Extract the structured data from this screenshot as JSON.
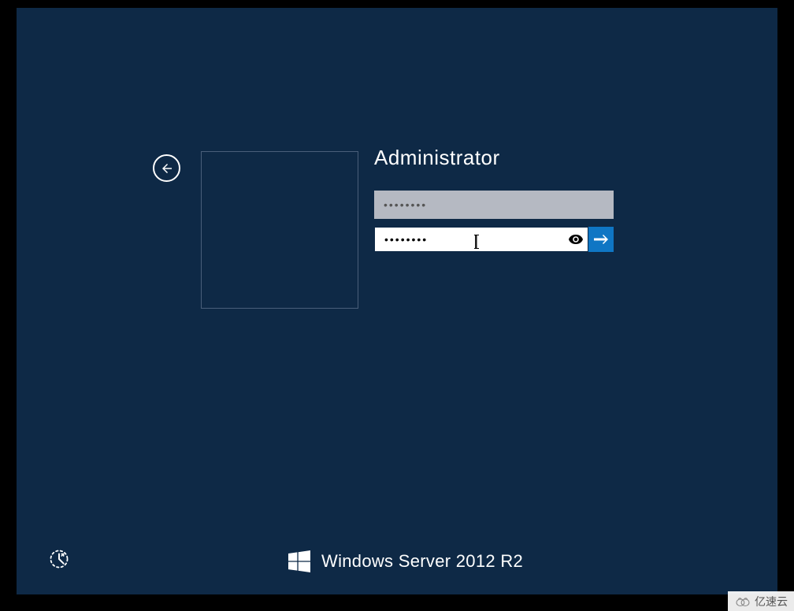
{
  "login": {
    "username": "Administrator",
    "password1_value": "••••••••",
    "password2_value": "••••••••",
    "password2_masked_display": "••••••••"
  },
  "branding": {
    "text": "Windows Server 2012 R2"
  },
  "watermark": {
    "text": "亿速云"
  },
  "colors": {
    "background": "#0e2946",
    "accent": "#0f76c4"
  }
}
